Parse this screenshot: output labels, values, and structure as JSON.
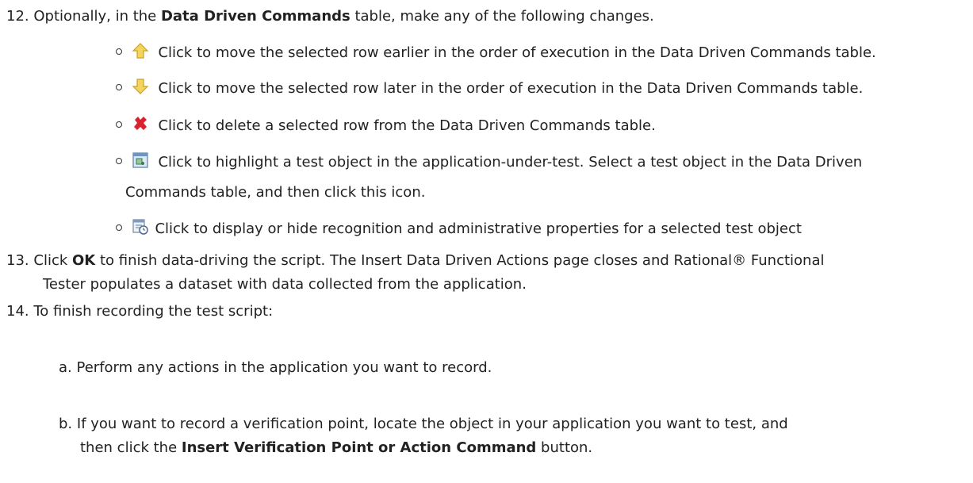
{
  "step12": {
    "number": "12.",
    "text_a": "Optionally, in the ",
    "text_bold": "Data Driven Commands",
    "text_b": " table, make any of the following changes.",
    "items": [
      {
        "icon": "arrow-up-icon",
        "text": "Click to move the selected row earlier in the order of execution in the Data Driven Commands table."
      },
      {
        "icon": "arrow-down-icon",
        "text": "Click to move the selected row later in the order of execution in the Data Driven Commands table."
      },
      {
        "icon": "delete-icon",
        "text": "Click to delete a selected row from the Data Driven Commands table."
      },
      {
        "icon": "highlight-object-icon",
        "text_1": "Click to highlight a test object in the application-under-test. Select a test object in the Data Driven",
        "text_2": "Commands table, and then click this icon."
      },
      {
        "icon": "properties-icon",
        "text": "Click to display or hide recognition and administrative properties for a selected test object"
      }
    ]
  },
  "step13": {
    "number": "13.",
    "text_a": "Click ",
    "text_bold": "OK",
    "text_b": " to finish data-driving the script. The Insert Data Driven Actions page closes and Rational® Functional",
    "text_2": "Tester populates a dataset with data collected from the application."
  },
  "step14": {
    "number": "14.",
    "text": "To finish recording the test script:",
    "sub": [
      {
        "label": "a.",
        "text": "Perform any actions in the application you want to record."
      },
      {
        "label": "b.",
        "text_1": "If you want to record a verification point, locate the object in your application you want to test, and",
        "text_2a": "then click the ",
        "text_bold": "Insert Verification Point or Action Command",
        "text_2b": " button."
      }
    ]
  },
  "colors": {
    "arrow_fill": "#f4d35e",
    "arrow_stroke": "#c9a227",
    "delete_red": "#d9232e"
  }
}
